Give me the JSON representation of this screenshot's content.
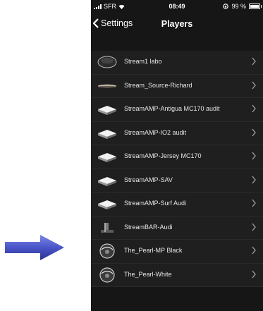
{
  "status_bar": {
    "carrier": "SFR",
    "time": "08:49",
    "battery": "99 %"
  },
  "nav": {
    "back_label": "Settings",
    "title": "Players"
  },
  "players": [
    {
      "name": "Stream1 labo",
      "icon": "speaker-oval-icon"
    },
    {
      "name": "Stream_Source-Richard",
      "icon": "flat-source-icon"
    },
    {
      "name": "StreamAMP-Antigua MC170 audit",
      "icon": "amp-box-icon"
    },
    {
      "name": "StreamAMP-IO2 audit",
      "icon": "amp-box-icon"
    },
    {
      "name": "StreamAMP-Jersey MC170",
      "icon": "amp-box-icon"
    },
    {
      "name": "StreamAMP-SAV",
      "icon": "amp-box-icon"
    },
    {
      "name": "StreamAMP-Surf Audi",
      "icon": "amp-box-icon"
    },
    {
      "name": "StreamBAR-Audi",
      "icon": "soundbar-icon"
    },
    {
      "name": "The_Pearl-MP Black",
      "icon": "pearl-speaker-icon"
    },
    {
      "name": "The_Pearl-White",
      "icon": "pearl-speaker-icon"
    }
  ],
  "colors": {
    "arrow": "#4a55c9",
    "background": "#161616",
    "row": "#1f1f1f"
  }
}
